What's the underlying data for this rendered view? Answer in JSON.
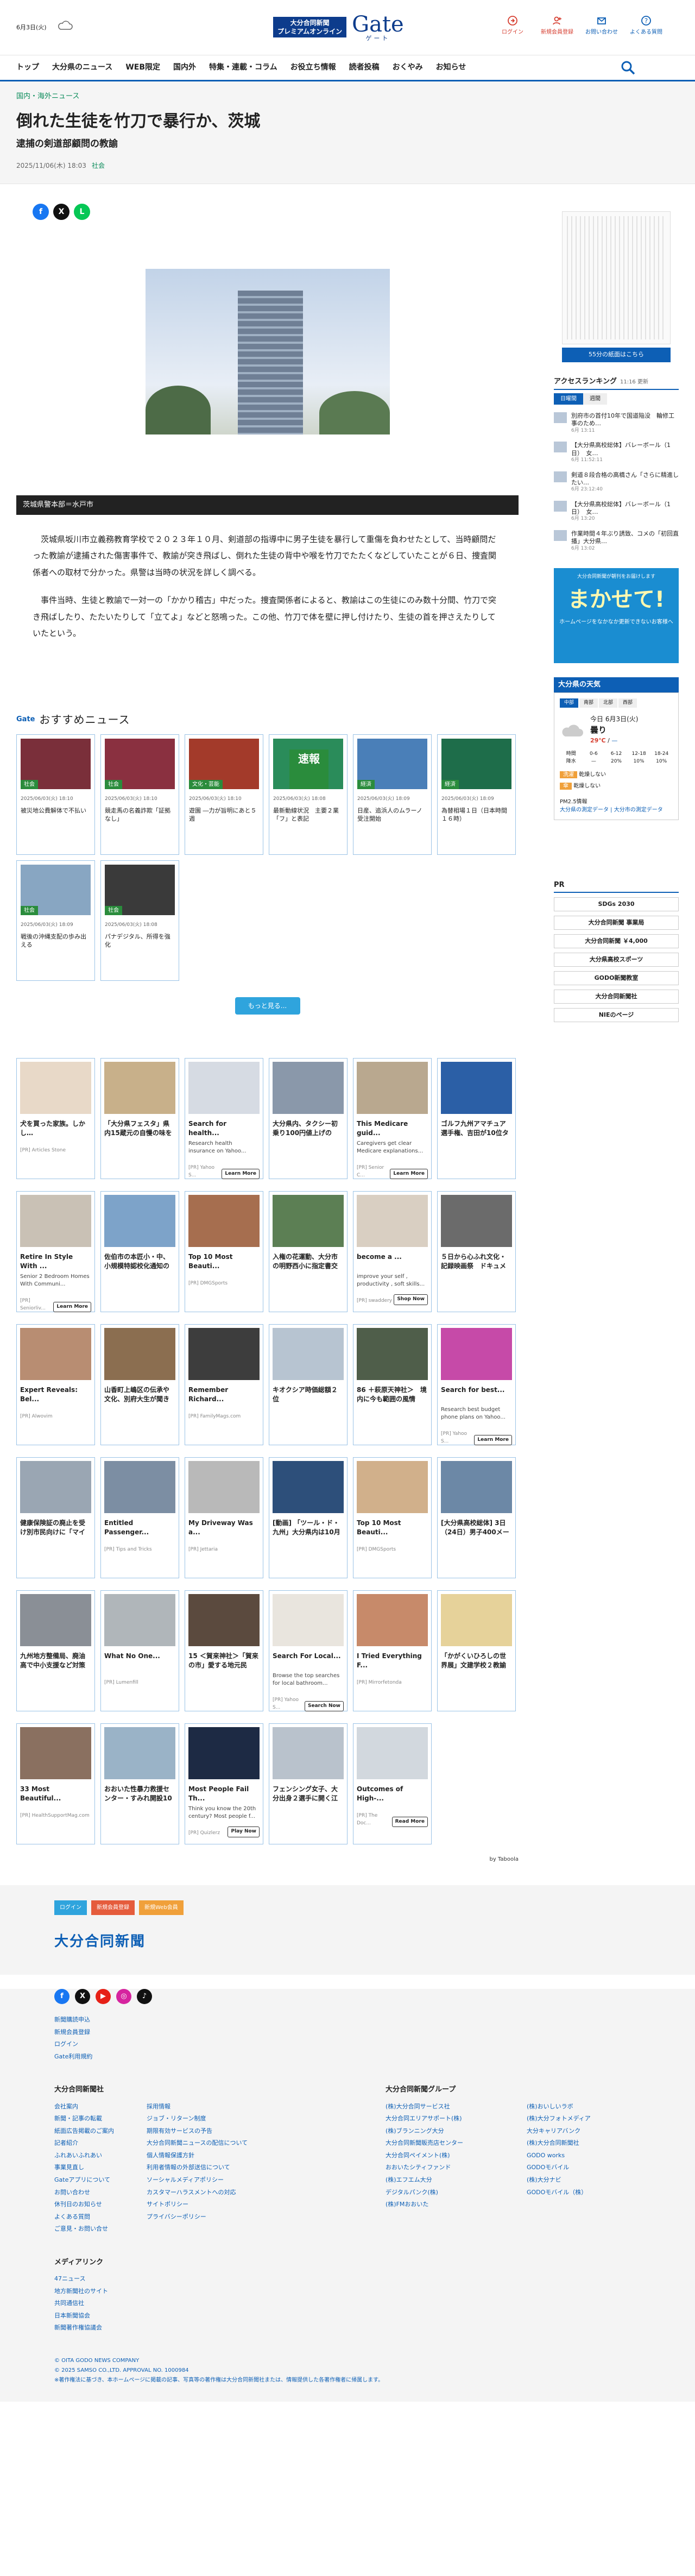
{
  "header": {
    "date": "6月3日",
    "weekday": "(火)",
    "logo_badge": "大分合同新聞\nプレミアムオンライン",
    "logo_name": "Gate",
    "logo_kana": "ゲート",
    "util": [
      {
        "label": "ログイン"
      },
      {
        "label": "新規会員登録"
      },
      {
        "label": "お問い合わせ"
      },
      {
        "label": "よくある質問"
      }
    ]
  },
  "nav": [
    "トップ",
    "大分県のニュース",
    "WEB限定",
    "国内外",
    "特集・連載・コラム",
    "お役立ち情報",
    "読者投稿",
    "おくやみ",
    "お知らせ"
  ],
  "article": {
    "crumb": "国内・海外ニュース",
    "title": "倒れた生徒を竹刀で暴行か、茨城",
    "subtitle": "逮捕の剣道部顧問の教諭",
    "date": "2025/11/06(木) 18:03",
    "category": "社会",
    "caption": "茨城県警本部＝水戸市",
    "paragraphs": [
      "茨城県坂川市立義務教育学校で２０２３年１０月、剣道部の指導中に男子生徒を暴行して重傷を負わせたとして、当時顧問だった教諭が逮捕された傷害事件で、教諭が突き飛ばし、倒れた生徒の背中や喉を竹刀でたたくなどしていたことが６日、捜査関係者への取材で分かった。県警は当時の状況を詳しく調べる。",
      "事件当時、生徒と教諭で一対一の「かかり稽古」中だった。捜査関係者によると、教諭はこの生徒にのみ数十分間、竹刀で突き飛ばしたり、たたいたりして「立てよ」などと怒鳴った。この他、竹刀で体を壁に押し付けたり、生徒の首を押さえたりしていたという。"
    ]
  },
  "recommend": {
    "gate": "Gate",
    "title": "おすすめニュース",
    "more": "もっと見る...",
    "items": [
      {
        "badge": "社会",
        "date": "2025/06/03(火) 18:10",
        "text": "被災地公費解体で不払い"
      },
      {
        "badge": "社会",
        "date": "2025/06/03(火) 18:10",
        "text": "競走馬の名義詐欺「証拠なし」"
      },
      {
        "badge": "文化・芸能",
        "date": "2025/06/03(火) 18:10",
        "text": "遊園 ―力が旨明にあと５週"
      },
      {
        "badge": "速報",
        "date": "2025/06/03(火) 18:08",
        "text": "最新動線状況　主要２業「フ」と表記"
      },
      {
        "badge": "経済",
        "date": "2025/06/03(火) 18:09",
        "text": "日産、追浜人のムラーノ受注開始"
      },
      {
        "badge": "経済",
        "date": "2025/06/03(火) 18:09",
        "text": "為替相場１日（日本時間１６時）"
      },
      {
        "badge": "社会",
        "date": "2025/06/03(火) 18:09",
        "text": "戦後の沖縄支配の歩み出える"
      },
      {
        "badge": "社会",
        "date": "2025/06/03(火) 18:08",
        "text": "パナデジタル、所得を強化"
      }
    ]
  },
  "taboola": {
    "brand": "by Taboola",
    "items": [
      {
        "title": "犬を買った家族。しかし…",
        "src": "[PR] Articles Stone",
        "c": "#e8d9c8"
      },
      {
        "title": "「大分県フェスタ」県内15蔵元の自慢の味を堪能　企業や行政機…",
        "src": "",
        "c": "#c8b08a"
      },
      {
        "title": "Search for health...",
        "src": "[PR] Yahoo S...",
        "ad": "Research health insurance on Yahoo...",
        "btn": "Learn More",
        "c": "#d6dbe3"
      },
      {
        "title": "大分県内、タクシー初乗り100円値上げの600円に　燃料費高止ま…",
        "src": "",
        "c": "#8a98aa"
      },
      {
        "title": "This Medicare guid...",
        "src": "[PR] Senior C...",
        "ad": "Caregivers get clear Medicare explanations...",
        "btn": "Learn More",
        "c": "#b9a88f"
      },
      {
        "title": "ゴルフ九州アマチュア選手権、吉田が10位タイで日本選手権の出…",
        "src": "",
        "c": "#2b5fa6"
      },
      {
        "title": "Retire In Style With ...",
        "src": "[PR] Seniorliv...",
        "ad": "Senior 2 Bedroom Homes With Communi...",
        "btn": "Learn More",
        "c": "#c9c1b5"
      },
      {
        "title": "佐伯市の本匠小・中、小規模特認校化通知の会同運動会　児童生…",
        "src": "",
        "c": "#7da3c9"
      },
      {
        "title": "Top 10 Most Beauti...",
        "src": "[PR] DMGSports",
        "c": "#a66e4f"
      },
      {
        "title": "入権の花運動、大分市の明野西小に指定書交付　「全校で笑顔の…",
        "src": "",
        "c": "#5c7f54"
      },
      {
        "title": "become a ...",
        "src": "[PR] swaddery",
        "ad": "improve your self , productivity , soft skills...",
        "btn": "Shop Now",
        "c": "#d9cfc2"
      },
      {
        "title": "５日から心ふれ文化・記録映画祭　ドキュメンタリー中心に…",
        "src": "",
        "c": "#6b6b6b"
      },
      {
        "title": "Expert Reveals: Bel...",
        "src": "[PR] Alwovim",
        "c": "#b88d72"
      },
      {
        "title": "山香町上嶋区の伝承や文化、別府大生が聞き取り　報告書作成へ…",
        "src": "",
        "c": "#8b6e50"
      },
      {
        "title": "Remember Richard...",
        "src": "[PR] FamilyMags.com",
        "c": "#3d3d3d"
      },
      {
        "title": "キオクシア時価総額２位",
        "src": "",
        "c": "#b7c4d1"
      },
      {
        "title": "86 ＋萩原天神社＞　境内に今も範囲の風情",
        "src": "",
        "c": "#4f5e4a"
      },
      {
        "title": "Search for best...",
        "src": "[PR] Yahoo S...",
        "ad": "Research best budget phone plans on Yahoo...",
        "btn": "Learn More",
        "c": "#c64aa8"
      },
      {
        "title": "健康保険証の廃止を受け別市民向けに「マイナ保険証ガイド」…",
        "src": "",
        "c": "#9aa6b3"
      },
      {
        "title": "Entitled Passenger...",
        "src": "[PR] Tips and Tricks",
        "c": "#7c8ea3"
      },
      {
        "title": "My Driveway Was a...",
        "src": "[PR] Jettaria",
        "c": "#b9b9b9"
      },
      {
        "title": "[動画] 「ツール・ド・九州」大分県内は10月11日に豊後大野…",
        "src": "",
        "c": "#2d4f7a"
      },
      {
        "title": "Top 10 Most Beauti...",
        "src": "[PR] DMGSports",
        "c": "#d1b08b"
      },
      {
        "title": "[大分県高校総体] 3日（24日）男子400メートルリレー、男…",
        "src": "",
        "c": "#6c88a6"
      },
      {
        "title": "九州地方整備局、廃油高で中小支援など対策を要望へ　他の分野…",
        "src": "",
        "c": "#8a8f96"
      },
      {
        "title": "What No One...",
        "src": "[PR] Lumenfill",
        "c": "#b0b6ba"
      },
      {
        "title": "15 ＜賀来神社＞「賀来の市」愛する地元民",
        "src": "",
        "c": "#5b4a3e"
      },
      {
        "title": "Search For Local...",
        "src": "[PR] Yahoo S...",
        "ad": "Browse the top searches for local bathroom...",
        "btn": "Search Now",
        "c": "#e9e5de"
      },
      {
        "title": "I Tried Everything F...",
        "src": "[PR] Mirrorfetonda",
        "c": "#c78a6a"
      },
      {
        "title": "「かがくいひろしの世界展」文建学校２教諭が聞き語る　短い言…",
        "src": "",
        "c": "#e6d29a"
      },
      {
        "title": "33 Most Beautiful...",
        "src": "[PR] HealthSupportMag.com",
        "c": "#8a7060"
      },
      {
        "title": "おおいた性暴力救援センター・すみれ開設10年　知人や友人から…",
        "src": "",
        "c": "#9ab3c7"
      },
      {
        "title": "Most People Fail Th...",
        "src": "[PR] Quizlerz",
        "ad": "Think you know the 20th century? Most people f...",
        "btn": "Play Now",
        "c": "#1d2a44"
      },
      {
        "title": "フェンシング女子、大分出身２選手に開く江村「やり切れると…",
        "src": "",
        "c": "#b9c2cc"
      },
      {
        "title": "Outcomes of High-...",
        "src": "[PR] The Doc...",
        "btn": "Read More",
        "c": "#d2d8de"
      }
    ]
  },
  "side": {
    "paper_btn": "55分の紙面はこちら",
    "access": "アクセスランキング",
    "access_sub": "11:16 更新",
    "tabs": [
      "日曜間",
      "週間"
    ],
    "rank": [
      {
        "t": "別府市の首付10年で国道陥没　輪修工事のため…",
        "d": "6月 13:11"
      },
      {
        "t": "【大分県高校総体】バレーボール（1日）　女…",
        "d": "6月 11:52:11"
      },
      {
        "t": "剣道８段合格の高橋さん「さらに精進したい…",
        "d": "6月 23:12:40"
      },
      {
        "t": "【大分県高校総体】バレーボール（1日）　女…",
        "d": "6月 13:20"
      },
      {
        "t": "作業時間４年ぶり誘致、コメの「初回直播」大分県…",
        "d": "6月 13:02"
      }
    ],
    "banner_top": "大分合同新聞が朝刊をお届けします",
    "banner_main": "まかせて!",
    "banner_sub": "ホームページをなかなか更新できないお客様へ",
    "weather": "大分県の天気",
    "weather_tabs": [
      "中部",
      "南部",
      "北部",
      "西部"
    ],
    "wx_date": "今日 6月3日(火)",
    "wx_cond": "曇り",
    "wx_hi": "29℃",
    "wx_lo": "—",
    "wx_times": [
      "時間",
      "0-6",
      "6-12",
      "12-18",
      "18-24"
    ],
    "wx_pct": [
      "降水",
      "—",
      "20%",
      "10%",
      "10%"
    ],
    "wx_note": [
      "洗濯",
      "乾燥しない"
    ],
    "wx_note2": [
      "傘",
      "乾燥しない"
    ],
    "pm": "PM2.5情報",
    "pm_link": "大分県の測定データ | 大分市の測定データ",
    "pr": "PR",
    "pr_items": [
      "SDGs 2030",
      "大分合同新聞 事業局",
      "大分合同新聞 ￥4,000",
      "大分県高校スポーツ",
      "GODO新聞教室",
      "大分合同新聞社",
      "NIEのページ"
    ]
  },
  "footer": {
    "btns": [
      "ログイン",
      "新規会員登録",
      "新規Web会員"
    ],
    "logo": "大分合同新聞",
    "links": [
      "新聞購読申込",
      "新規会員登録",
      "ログイン",
      "Gate利用規約"
    ],
    "col_h": "大分合同新聞社",
    "col_h2": "大分合同新聞グループ",
    "c1": [
      "会社案内",
      "新聞・記事の転載",
      "紙面広告掲載のご案内",
      "記者紹介",
      "ふれあいふれあい",
      "事業見直し",
      "Gateアプリについて",
      "お問い合わせ",
      "休刊日のお知らせ",
      "よくある質問",
      "ご意見・お問い合せ"
    ],
    "c2": [
      "採用情報",
      "ジョブ・リターン制度",
      "期限有効サービスの予告",
      "大分合同新聞ニュースの配信について",
      "個人情報保護方針",
      "利用者情報の外部送信について",
      "ソーシャルメディアポリシー",
      "カスタマーハラスメントへの対応",
      "サイトポリシー",
      "プライバシーポリシー"
    ],
    "c3": [
      "(株)大分合同サービス社",
      "大分合同エリアサポート(株)",
      "(株)ブランニング大分",
      "大分合同新聞販売店センター",
      "大分合同ペイメント(株)",
      "おおいたシティファンド",
      "(株)エフエム大分",
      "デジタルパンク(株)",
      "(株)FMおおいた"
    ],
    "c4": [
      "(株)おいしいラボ",
      "(株)大分フォトメディア",
      "大分キャリアバンク",
      "(株)大分合同新聞社",
      "GODO works",
      "GODOモバイル",
      "(株)大分ナビ",
      "GODOモバイル（株）"
    ],
    "media": "メディアリンク",
    "media_links": [
      "47ニュース",
      "地方新聞社のサイト",
      "共同通信社",
      "日本新聞協会",
      "新聞著作権協議会"
    ],
    "copy1": "© OITA GODO NEWS COMPANY",
    "copy2": "© 2025 SAMSO CO.,LTD. APPROVAL NO. 1000984",
    "copy3": "※著作権法に基づき、本ホームページに掲載の記事、写真等の著作権は大分合同新聞社または、情報提供した各著作権者に帰属します。"
  }
}
